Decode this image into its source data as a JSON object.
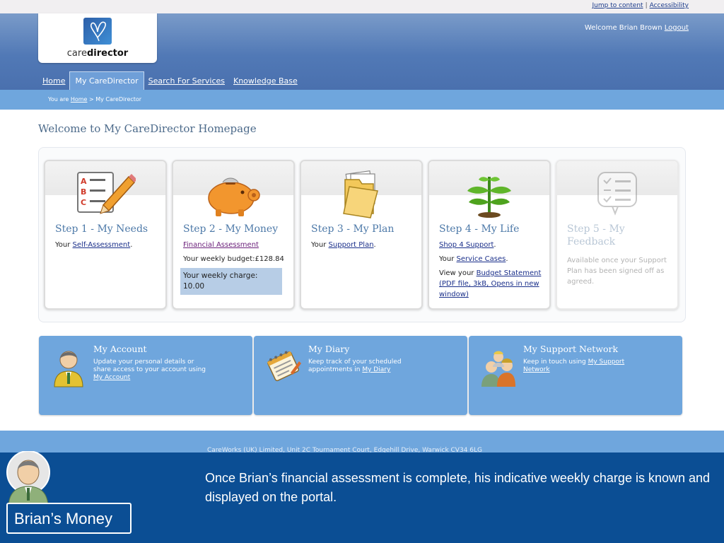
{
  "utility": {
    "jump_link": "Jump to content",
    "separator": "|",
    "accessibility_link": "Accessibility"
  },
  "header": {
    "logo_text_light": "care",
    "logo_text_bold": "director",
    "welcome_text": "Welcome  Brian Brown",
    "logout_label": "Logout"
  },
  "nav": {
    "items": [
      {
        "label": "Home"
      },
      {
        "label": "My CareDirector"
      },
      {
        "label": "Search For Services"
      },
      {
        "label": "Knowledge Base"
      }
    ]
  },
  "breadcrumb": {
    "prefix": "You are",
    "home": "Home",
    "current": " > My CareDirector"
  },
  "page_title": "Welcome to My CareDirector Homepage",
  "steps": {
    "s1": {
      "title": "Step 1 - My Needs",
      "text": "Your",
      "link": "Self-Assessment",
      "end": "."
    },
    "s2": {
      "title": "Step 2 - My Money",
      "link": "Financial Assessment",
      "budget": "Your weekly budget:£128.84",
      "charge": "Your weekly charge: 10.00"
    },
    "s3": {
      "title": "Step 3 - My Plan",
      "text": "Your",
      "link": "Support Plan",
      "end": "."
    },
    "s4": {
      "title": "Step 4 - My Life",
      "link1": "Shop 4 Support",
      "end1": ".",
      "text2": "Your",
      "link2": "Service Cases",
      "end2": ".",
      "text3": "View your",
      "link3": "Budget Statement (PDF file, 3kB, Opens in new window)"
    },
    "s5": {
      "title": "Step 5 - My Feedback",
      "text": "Available once your Support Plan has been signed off as agreed."
    }
  },
  "tiles": {
    "account": {
      "title": "My Account",
      "text": "Update your personal details or share access to your account using",
      "link": "My Account"
    },
    "diary": {
      "title": "My Diary",
      "text": "Keep track of your scheduled appointments in",
      "link": "My Diary"
    },
    "network": {
      "title": "My Support Network",
      "text": "Keep in touch using",
      "link": "My Support Network"
    }
  },
  "footer": {
    "text": "CareWorks (UK) Limited, Unit 2C Tournament Court, Edgehill Drive, Warwick CV34 6LG"
  },
  "caption": {
    "persona_label": "Brian’s Money",
    "text": "Once Brian’s financial assessment is complete, his indicative weekly charge is known and displayed on the portal."
  },
  "colors": {
    "header_blue": "#5179b6",
    "light_blue": "#6fa6dd",
    "caption_blue": "#0b4e94",
    "title_blue": "#4d79a8"
  }
}
